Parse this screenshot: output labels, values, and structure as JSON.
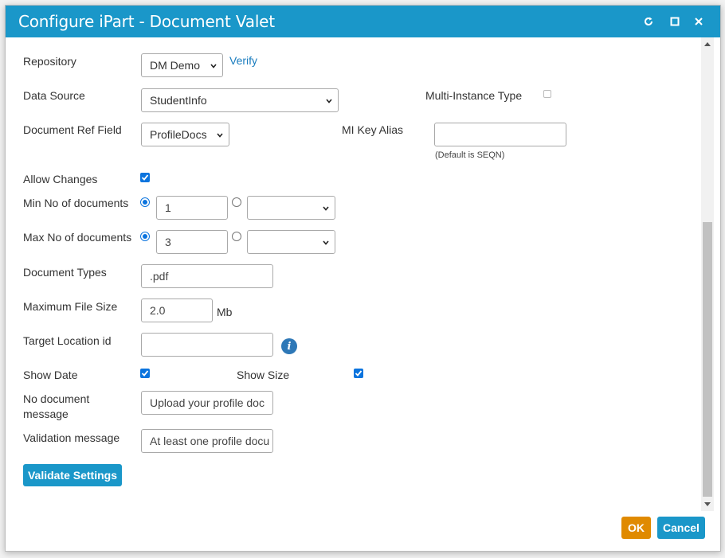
{
  "dialog": {
    "title": "Configure iPart - Document Valet",
    "icons": [
      "refresh-icon",
      "maximize-icon",
      "close-icon"
    ]
  },
  "form": {
    "repository": {
      "label": "Repository",
      "value": "DM Demo",
      "verify": "Verify"
    },
    "data_source": {
      "label": "Data Source",
      "value": "StudentInfo"
    },
    "multi_instance": {
      "label": "Multi-Instance Type",
      "checked": false
    },
    "doc_ref_field": {
      "label": "Document Ref Field",
      "value": "ProfileDocs"
    },
    "mi_key_alias": {
      "label": "MI Key Alias",
      "value": "",
      "hint": "(Default is SEQN)"
    },
    "allow_changes": {
      "label": "Allow Changes",
      "checked": true
    },
    "min_docs": {
      "label": "Min No of documents",
      "value": "1",
      "select_value": ""
    },
    "max_docs": {
      "label": "Max No of documents",
      "value": "3",
      "select_value": ""
    },
    "doc_types": {
      "label": "Document Types",
      "value": ".pdf"
    },
    "max_file_size": {
      "label": "Maximum File Size",
      "value": "2.0",
      "unit": "Mb"
    },
    "target_location": {
      "label": "Target Location id",
      "value": "",
      "info": "i"
    },
    "show_date": {
      "label": "Show Date",
      "checked": true
    },
    "show_size": {
      "label": "Show Size",
      "checked": true
    },
    "no_doc_message": {
      "label_line1": "No document",
      "label_line2": "message",
      "value": "Upload your profile doc"
    },
    "validation_message": {
      "label": "Validation message",
      "value": "At least one profile docu"
    },
    "validate_button": "Validate Settings"
  },
  "footer": {
    "ok": "OK",
    "cancel": "Cancel"
  },
  "colors": {
    "titlebar": "#1a97c9",
    "ok": "#e08a00",
    "cancel": "#1a97c9",
    "checkbox": "#0b74de"
  }
}
